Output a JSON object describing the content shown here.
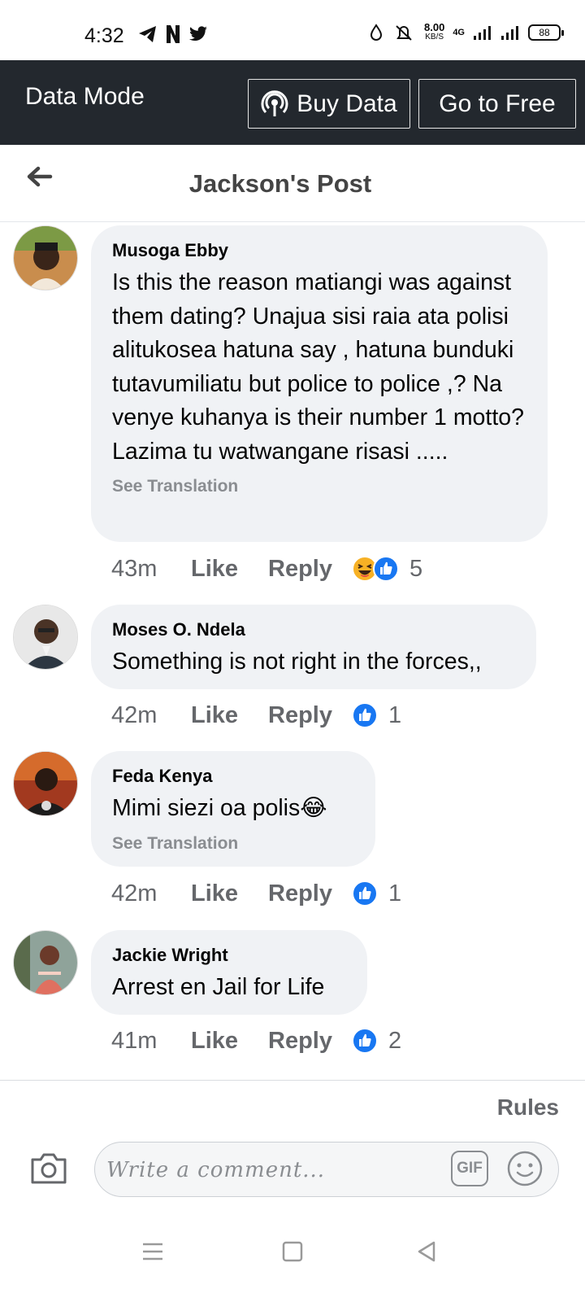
{
  "status_bar": {
    "time": "4:32",
    "speed_value": "8.00",
    "speed_unit": "KB/S",
    "network": "4G",
    "battery": "88"
  },
  "data_mode": {
    "label": "Data Mode",
    "buy_data": "Buy Data",
    "go_free": "Go to Free"
  },
  "header": {
    "title": "Jackson's Post"
  },
  "comments": [
    {
      "name": "Musoga Ebby",
      "text": "Is this the reason matiangi was against them dating? Unajua sisi raia ata polisi alitukosea hatuna say , hatuna bunduki tutavumiliatu but police to police ,? Na venye kuhanya is their number 1 motto? Lazima tu watwangane risasi .....",
      "see_translation": "See Translation",
      "time": "43m",
      "like": "Like",
      "reply": "Reply",
      "reactions": [
        "haha",
        "like"
      ],
      "reaction_count": "5"
    },
    {
      "name": "Moses O. Ndela",
      "text": "Something is not right in the forces,,",
      "time": "42m",
      "like": "Like",
      "reply": "Reply",
      "reactions": [
        "like"
      ],
      "reaction_count": "1"
    },
    {
      "name": "Feda Kenya",
      "text": "Mimi siezi oa polis😂",
      "see_translation": "See Translation",
      "time": "42m",
      "like": "Like",
      "reply": "Reply",
      "reactions": [
        "like"
      ],
      "reaction_count": "1"
    },
    {
      "name": "Jackie Wright",
      "text": "Arrest en Jail for Life",
      "time": "41m",
      "like": "Like",
      "reply": "Reply",
      "reactions": [
        "like"
      ],
      "reaction_count": "2"
    }
  ],
  "footer": {
    "rules": "Rules",
    "composer_placeholder": "Write a comment...",
    "gif_label": "GIF"
  },
  "colors": {
    "banner_bg": "#23282e",
    "bubble_bg": "#f0f2f5",
    "like_blue": "#1877f2",
    "muted_text": "#65676b"
  }
}
